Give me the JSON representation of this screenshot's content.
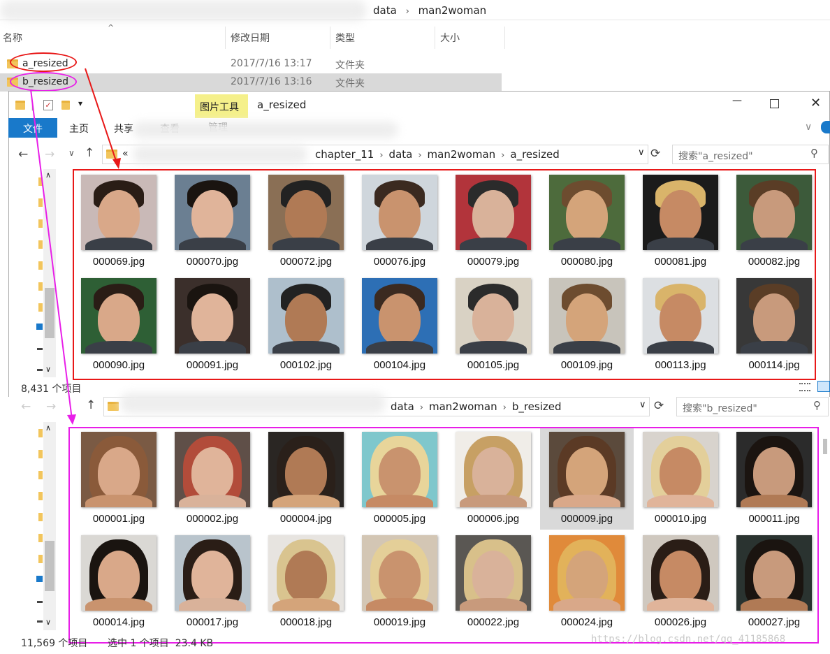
{
  "top_explorer": {
    "breadcrumb": [
      "data",
      "man2woman"
    ],
    "columns": {
      "name": "名称",
      "date": "修改日期",
      "type": "类型",
      "size": "大小"
    },
    "rows": [
      {
        "name": "a_resized",
        "date": "2017/7/16 13:17",
        "type": "文件夹"
      },
      {
        "name": "b_resized",
        "date": "2017/7/16 13:16",
        "type": "文件夹"
      }
    ]
  },
  "window_a": {
    "title": "a_resized",
    "context_tab": "图片工具",
    "ribbon_tabs": [
      "文件",
      "主页",
      "共享",
      "查看",
      "管理"
    ],
    "nav_prefix": "«",
    "breadcrumb": [
      "chapter_11",
      "data",
      "man2woman",
      "a_resized"
    ],
    "search_placeholder": "搜索\"a_resized\"",
    "status": "8,431 个项目",
    "files": [
      "000069.jpg",
      "000070.jpg",
      "000072.jpg",
      "000076.jpg",
      "000079.jpg",
      "000080.jpg",
      "000081.jpg",
      "000082.jpg",
      "000090.jpg",
      "000091.jpg",
      "000102.jpg",
      "000104.jpg",
      "000105.jpg",
      "000109.jpg",
      "000113.jpg",
      "000114.jpg"
    ]
  },
  "window_b": {
    "breadcrumb": [
      "data",
      "man2woman",
      "b_resized"
    ],
    "search_placeholder": "搜索\"b_resized\"",
    "status_count": "11,569 个项目",
    "status_selected": "选中 1 个项目  23.4 KB",
    "selected_file": "000009.jpg",
    "files": [
      "000001.jpg",
      "000002.jpg",
      "000004.jpg",
      "000005.jpg",
      "000006.jpg",
      "000009.jpg",
      "000010.jpg",
      "000011.jpg",
      "000014.jpg",
      "000017.jpg",
      "000018.jpg",
      "000019.jpg",
      "000022.jpg",
      "000024.jpg",
      "000026.jpg",
      "000027.jpg"
    ]
  },
  "watermark": "https://blog.csdn.net/qq_41185868",
  "colors": {
    "annotation_red": "#e81818",
    "annotation_magenta": "#e81ee8",
    "ribbon_file_tab": "#1979ca",
    "context_tab": "#f5f08a"
  }
}
